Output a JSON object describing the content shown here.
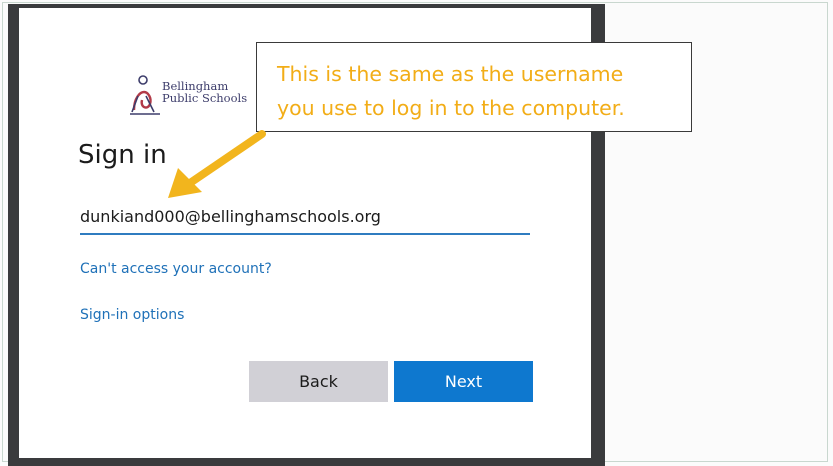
{
  "callout": {
    "line1": "This is the same as the username",
    "line2": "you use to log in to the computer."
  },
  "signin": {
    "logo_line1": "Bellingham",
    "logo_line2": "Public Schools",
    "title": "Sign in",
    "email_value": "dunkiand000@bellinghamschools.org",
    "link_cant_access": "Can't access your account?",
    "link_signin_options": "Sign-in options",
    "back_label": "Back",
    "next_label": "Next"
  },
  "colors": {
    "accent": "#0e78cf",
    "link": "#1f71b8",
    "callout_text": "#f2ad17",
    "arrow": "#f2b51d"
  }
}
